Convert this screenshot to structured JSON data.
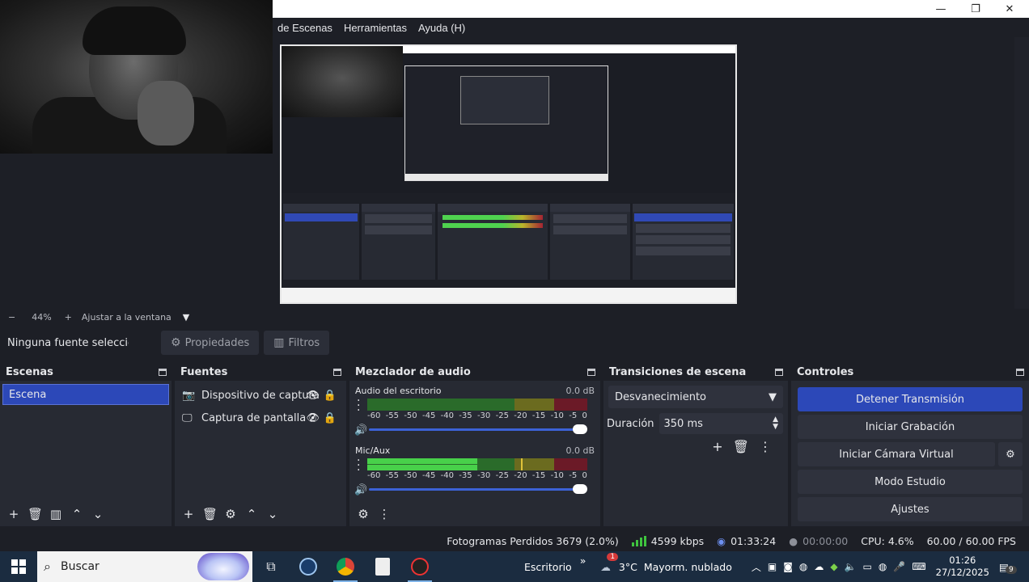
{
  "window": {
    "minimize": "—",
    "maximize": "❐",
    "close": "✕"
  },
  "menu": [
    "de Escenas",
    "Herramientas",
    "Ayuda (H)"
  ],
  "zoom": {
    "minus": "−",
    "value": "44%",
    "plus": "+",
    "fit": "Ajustar a la ventana",
    "arrow": "▼"
  },
  "source_toolbar": {
    "label": "Ninguna fuente seleccionada",
    "properties": "Propiedades",
    "filters": "Filtros"
  },
  "docks": {
    "scenes": {
      "title": "Escenas",
      "items": [
        "Escena"
      ]
    },
    "sources": {
      "title": "Fuentes",
      "items": [
        {
          "icon": "camera-icon",
          "label": "Dispositivo de captura"
        },
        {
          "icon": "monitor-icon",
          "label": "Captura de pantalla 2"
        }
      ]
    },
    "mixer": {
      "title": "Mezclador de audio",
      "channels": [
        {
          "name": "Audio del escritorio",
          "db": "0.0 dB",
          "level": 0,
          "peak": null
        },
        {
          "name": "Mic/Aux",
          "db": "0.0 dB",
          "level": 0.5,
          "peak": 0.7
        }
      ],
      "ticks": [
        "-60",
        "-55",
        "-50",
        "-45",
        "-40",
        "-35",
        "-30",
        "-25",
        "-20",
        "-15",
        "-10",
        "-5",
        "0"
      ]
    },
    "transitions": {
      "title": "Transiciones de escena",
      "selected": "Desvanecimiento",
      "duration_label": "Duración",
      "duration_value": "350 ms"
    },
    "controls": {
      "title": "Controles",
      "buttons": [
        "Detener Transmisión",
        "Iniciar Grabación",
        "Iniciar Cámara Virtual",
        "Modo Estudio",
        "Ajustes"
      ]
    }
  },
  "status": {
    "dropped": "Fotogramas Perdidos 3679 (2.0%)",
    "bitrate": "4599 kbps",
    "stream_time": "01:33:24",
    "rec_time": "00:00:00",
    "cpu": "CPU: 4.6%",
    "fps": "60.00 / 60.00 FPS"
  },
  "taskbar": {
    "search": "Buscar",
    "desktop": "Escritorio",
    "chevron": "»",
    "weather_temp": "3°C",
    "weather_text": "Mayorm. nublado",
    "weather_badge": "1",
    "time": "01:26",
    "date": "27/12/2025",
    "notif": "9"
  },
  "colors": {
    "accent": "#2c48b8",
    "meter_green": "#48d04a",
    "bg": "#1d1f26",
    "dock": "#272a33"
  }
}
